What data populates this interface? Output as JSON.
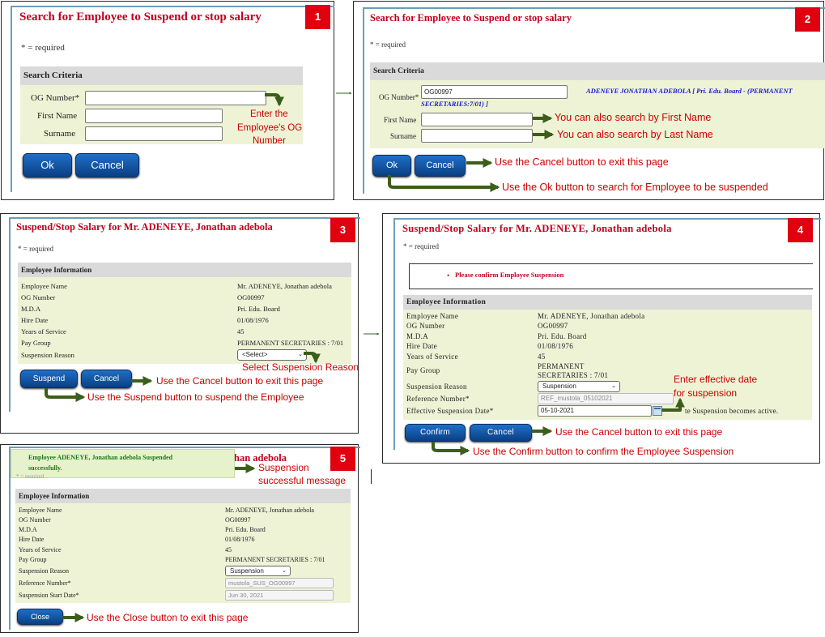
{
  "common": {
    "required_note": "* = required"
  },
  "step1": {
    "badge": "1",
    "title": "Search for Employee to Suspend or stop salary",
    "section": "Search Criteria",
    "labels": {
      "og": "OG Number*",
      "first": "First Name",
      "surname": "Surname"
    },
    "values": {
      "og": "",
      "first": "",
      "surname": ""
    },
    "buttons": {
      "ok": "Ok",
      "cancel": "Cancel"
    },
    "annotation": {
      "line1": "Enter the",
      "line2": "Employee's OG",
      "line3": "Number"
    }
  },
  "step2": {
    "badge": "2",
    "title": "Search for Employee to Suspend or stop salary",
    "section": "Search Criteria",
    "labels": {
      "og": "OG Number*",
      "first": "First Name",
      "surname": "Surname"
    },
    "values": {
      "og": "OG00997",
      "first": "",
      "surname": ""
    },
    "lookup": {
      "line1": "ADENEYE JONATHAN ADEBOLA [ Pri. Edu. Board - (PERMANENT",
      "line2": "SECRETARIES:7/01) ]"
    },
    "buttons": {
      "ok": "Ok",
      "cancel": "Cancel"
    },
    "annotations": {
      "first": "You can also search by First Name",
      "last": "You can also search by Last Name",
      "cancel": "Use the Cancel button to exit this page",
      "ok": "Use the Ok button to search for Employee to be suspended"
    }
  },
  "step3": {
    "badge": "3",
    "title": "Suspend/Stop Salary for Mr. ADENEYE, Jonathan adebola",
    "section": "Employee Information",
    "labels": {
      "name": "Employee Name",
      "og": "OG Number",
      "mda": "M.D.A",
      "hire": "Hire Date",
      "years": "Years of Service",
      "pay": "Pay Group",
      "reason": "Suspension Reason"
    },
    "values": {
      "name": "Mr. ADENEYE, Jonathan adebola",
      "og": "OG00997",
      "mda": "Pri. Edu. Board",
      "hire": "01/08/1976",
      "years": "45",
      "pay": "PERMANENT SECRETARIES : 7/01"
    },
    "select": "<Select>",
    "buttons": {
      "suspend": "Suspend",
      "cancel": "Cancel"
    },
    "annotations": {
      "reason": "Select Suspension Reason",
      "cancel": "Use the Cancel button to exit this page",
      "suspend": "Use the Suspend button to suspend the Employee"
    }
  },
  "step4": {
    "badge": "4",
    "title": "Suspend/Stop Salary for Mr. ADENEYE, Jonathan adebola",
    "alert": "Please confirm Employee Suspension",
    "section": "Employee Information",
    "labels": {
      "name": "Employee Name",
      "og": "OG Number",
      "mda": "M.D.A",
      "hire": "Hire Date",
      "years": "Years of Service",
      "pay": "Pay Group",
      "reason": "Suspension Reason",
      "ref": "Reference Number*",
      "eff": "Effective Suspension Date*"
    },
    "values": {
      "name": "Mr. ADENEYE, Jonathan adebola",
      "og": "OG00997",
      "mda": "Pri. Edu. Board",
      "hire": "01/08/1976",
      "years": "45",
      "pay1": "PERMANENT",
      "pay2": "SECRETARIES : 7/01",
      "reason": "Suspension",
      "ref": "REF_mustola_05102021",
      "eff": "05-10-2021"
    },
    "note_tail": "te Suspension becomes active.",
    "buttons": {
      "confirm": "Confirm",
      "cancel": "Cancel"
    },
    "annotations": {
      "date1": "Enter effective date",
      "date2": "for suspension",
      "cancel": "Use the Cancel button to exit this page",
      "confirm": "Use the Confirm button to confirm the Employee Suspension"
    }
  },
  "step5": {
    "badge": "5",
    "title_tail": "han adebola",
    "success": {
      "line1": "Employee ADENEYE, Jonathan adebola Suspended",
      "line2": "successfully."
    },
    "req_tail": "* = required",
    "section": "Employee Information",
    "labels": {
      "name": "Employee Name",
      "og": "OG Number",
      "mda": "M.D.A",
      "hire": "Hire Date",
      "years": "Years of Service",
      "pay": "Pay Group",
      "reason": "Suspension Reason",
      "ref": "Reference Number*",
      "start": "Suspension Start Date*"
    },
    "values": {
      "name": "Mr. ADENEYE, Jonathan adebola",
      "og": "OG00997",
      "mda": "Pri. Edu. Board",
      "hire": "01/08/1976",
      "years": "45",
      "pay": "PERMANENT SECRETARIES : 7/01",
      "reason": "Suspension",
      "ref": "mustola_SUS_OG00997",
      "start": "Jun 30, 2021"
    },
    "buttons": {
      "close": "Close"
    },
    "annotations": {
      "success1": "Suspension",
      "success2": "successful message",
      "close": "Use the Close button to exit this page"
    }
  },
  "colors": {
    "title": "#c00020",
    "badge": "#e0000f",
    "annotation": "#cc0000",
    "arrow": "#3d5e1a",
    "button": "#0a3f82",
    "form_bg": "#eef3d6",
    "lookup": "#1a1ad0",
    "success": "#1a7a1a"
  }
}
